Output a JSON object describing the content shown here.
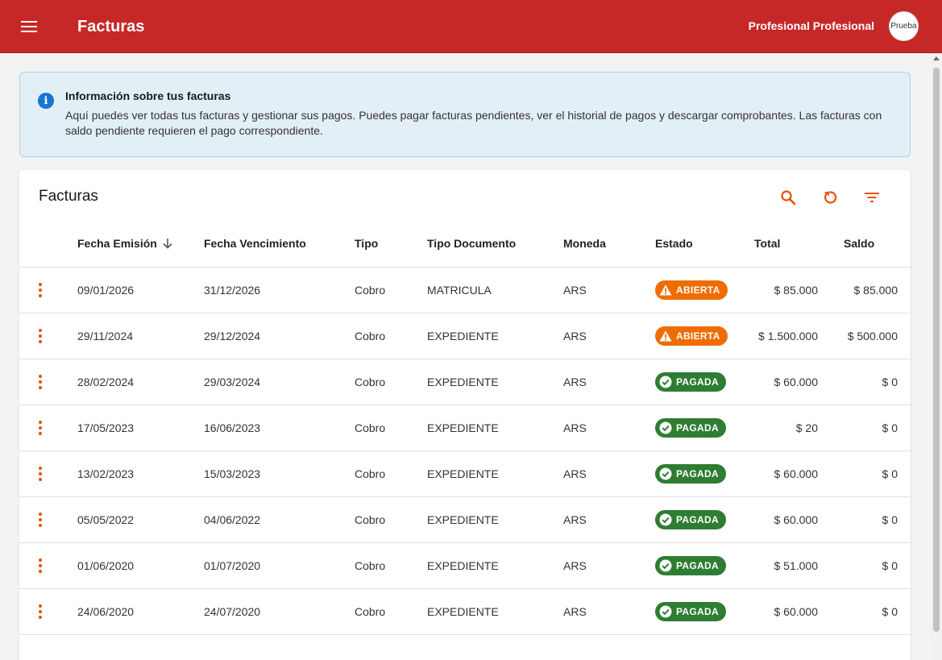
{
  "app": {
    "title": "Facturas",
    "user_name": "Profesional Profesional",
    "avatar_text": "Prueba"
  },
  "info": {
    "title": "Información sobre tus facturas",
    "text": "Aquí puedes ver todas tus facturas y gestionar sus pagos. Puedes pagar facturas pendientes, ver el historial de pagos y descargar comprobantes. Las facturas con saldo pendiente requieren el pago correspondiente."
  },
  "card": {
    "title": "Facturas",
    "tools": [
      "search-icon",
      "refresh-icon",
      "filter-icon"
    ]
  },
  "table": {
    "columns": {
      "fecha_emision": "Fecha Emisión",
      "fecha_vencimiento": "Fecha Vencimiento",
      "tipo": "Tipo",
      "tipo_documento": "Tipo Documento",
      "moneda": "Moneda",
      "estado": "Estado",
      "total": "Total",
      "saldo": "Saldo"
    },
    "sort_icon": "arrow-down-icon",
    "rows": [
      {
        "fecha_emision": "09/01/2026",
        "fecha_vencimiento": "31/12/2026",
        "tipo": "Cobro",
        "tipo_documento": "MATRICULA",
        "moneda": "ARS",
        "estado": "ABIERTA",
        "total": "$ 85.000",
        "saldo": "$ 85.000"
      },
      {
        "fecha_emision": "29/11/2024",
        "fecha_vencimiento": "29/12/2024",
        "tipo": "Cobro",
        "tipo_documento": "EXPEDIENTE",
        "moneda": "ARS",
        "estado": "ABIERTA",
        "total": "$ 1.500.000",
        "saldo": "$ 500.000"
      },
      {
        "fecha_emision": "28/02/2024",
        "fecha_vencimiento": "29/03/2024",
        "tipo": "Cobro",
        "tipo_documento": "EXPEDIENTE",
        "moneda": "ARS",
        "estado": "PAGADA",
        "total": "$ 60.000",
        "saldo": "$ 0"
      },
      {
        "fecha_emision": "17/05/2023",
        "fecha_vencimiento": "16/06/2023",
        "tipo": "Cobro",
        "tipo_documento": "EXPEDIENTE",
        "moneda": "ARS",
        "estado": "PAGADA",
        "total": "$ 20",
        "saldo": "$ 0"
      },
      {
        "fecha_emision": "13/02/2023",
        "fecha_vencimiento": "15/03/2023",
        "tipo": "Cobro",
        "tipo_documento": "EXPEDIENTE",
        "moneda": "ARS",
        "estado": "PAGADA",
        "total": "$ 60.000",
        "saldo": "$ 0"
      },
      {
        "fecha_emision": "05/05/2022",
        "fecha_vencimiento": "04/06/2022",
        "tipo": "Cobro",
        "tipo_documento": "EXPEDIENTE",
        "moneda": "ARS",
        "estado": "PAGADA",
        "total": "$ 60.000",
        "saldo": "$ 0"
      },
      {
        "fecha_emision": "01/06/2020",
        "fecha_vencimiento": "01/07/2020",
        "tipo": "Cobro",
        "tipo_documento": "EXPEDIENTE",
        "moneda": "ARS",
        "estado": "PAGADA",
        "total": "$ 51.000",
        "saldo": "$ 0"
      },
      {
        "fecha_emision": "24/06/2020",
        "fecha_vencimiento": "24/07/2020",
        "tipo": "Cobro",
        "tipo_documento": "EXPEDIENTE",
        "moneda": "ARS",
        "estado": "PAGADA",
        "total": "$ 60.000",
        "saldo": "$ 0"
      }
    ]
  },
  "colors": {
    "appbar": "#c62828",
    "accent": "#e65100",
    "status_abierta": "#ef6c00",
    "status_pagada": "#2e7d32",
    "info_bg": "#e3eff6",
    "info_icon": "#1976d2"
  }
}
